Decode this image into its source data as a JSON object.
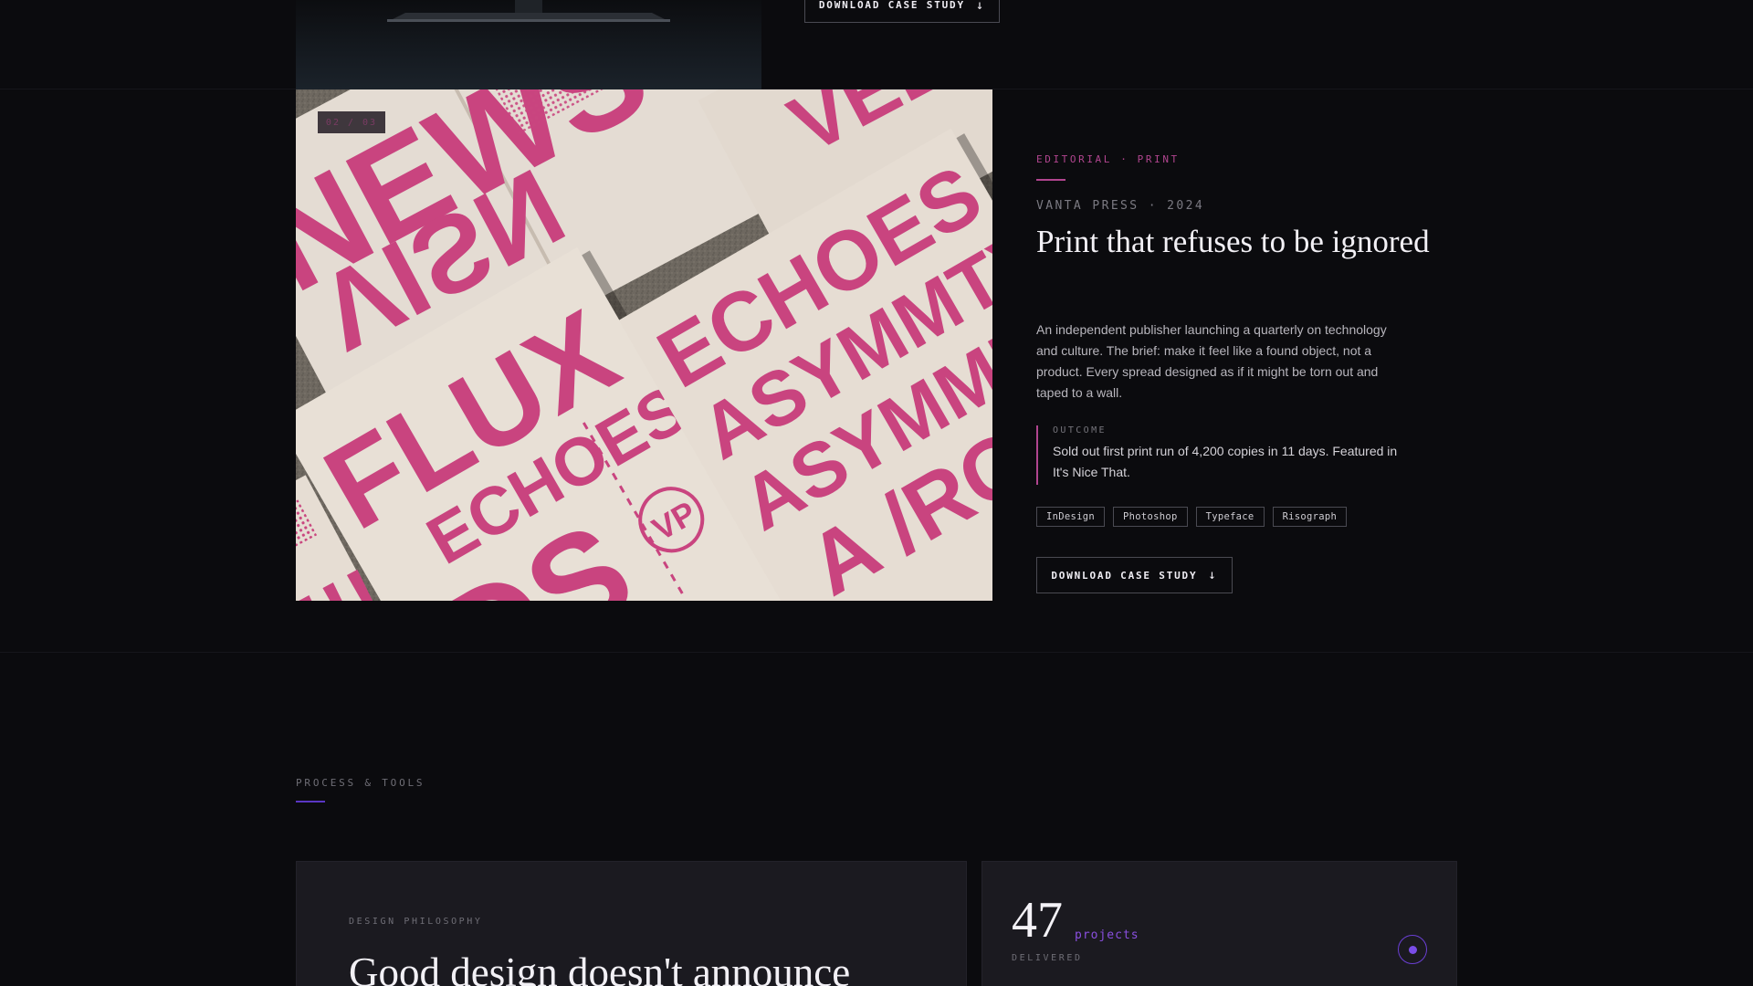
{
  "previous_project": {
    "download_label": "DOWNLOAD CASE STUDY"
  },
  "project": {
    "badge": "02 / 03",
    "category": "EDITORIAL · PRINT",
    "client_year": "VANTA PRESS · 2024",
    "title": "Print that refuses to be ignored",
    "description": "An independent publisher launching a quarterly on technology and culture. The brief: make it feel like a found object, not a product. Every spread designed as if it might be torn out and taped to a wall.",
    "outcome_label": "OUTCOME",
    "outcome_text": "Sold out first print run of 4,200 copies in 11 days. Featured in It's Nice That.",
    "tags": [
      "InDesign",
      "Photoshop",
      "Typeface",
      "Risograph"
    ],
    "download_label": "DOWNLOAD CASE STUDY",
    "image_words": {
      "top_left_a": "NEWS",
      "top_left_b": "VISN",
      "top_right": "VEL",
      "left_mag_1": "FLUX",
      "left_mag_2": "ECHOES",
      "left_mag_3": "DS",
      "right_mag_1": "ECHOES",
      "right_mag_2": "ASYMMTY",
      "right_mag_3": "ASYMME",
      "right_mag_4": "A /RC",
      "logo": "VP",
      "bottom_left": "!!!"
    },
    "accent_color": "#b1458f"
  },
  "process": {
    "section_label": "PROCESS & TOOLS",
    "philosophy_label": "DESIGN PHILOSOPHY",
    "philosophy_title": "Good design doesn't announce",
    "stat_number": "47",
    "stat_unit": "projects",
    "stat_label": "DELIVERED",
    "accent_color": "#5a36c4"
  }
}
